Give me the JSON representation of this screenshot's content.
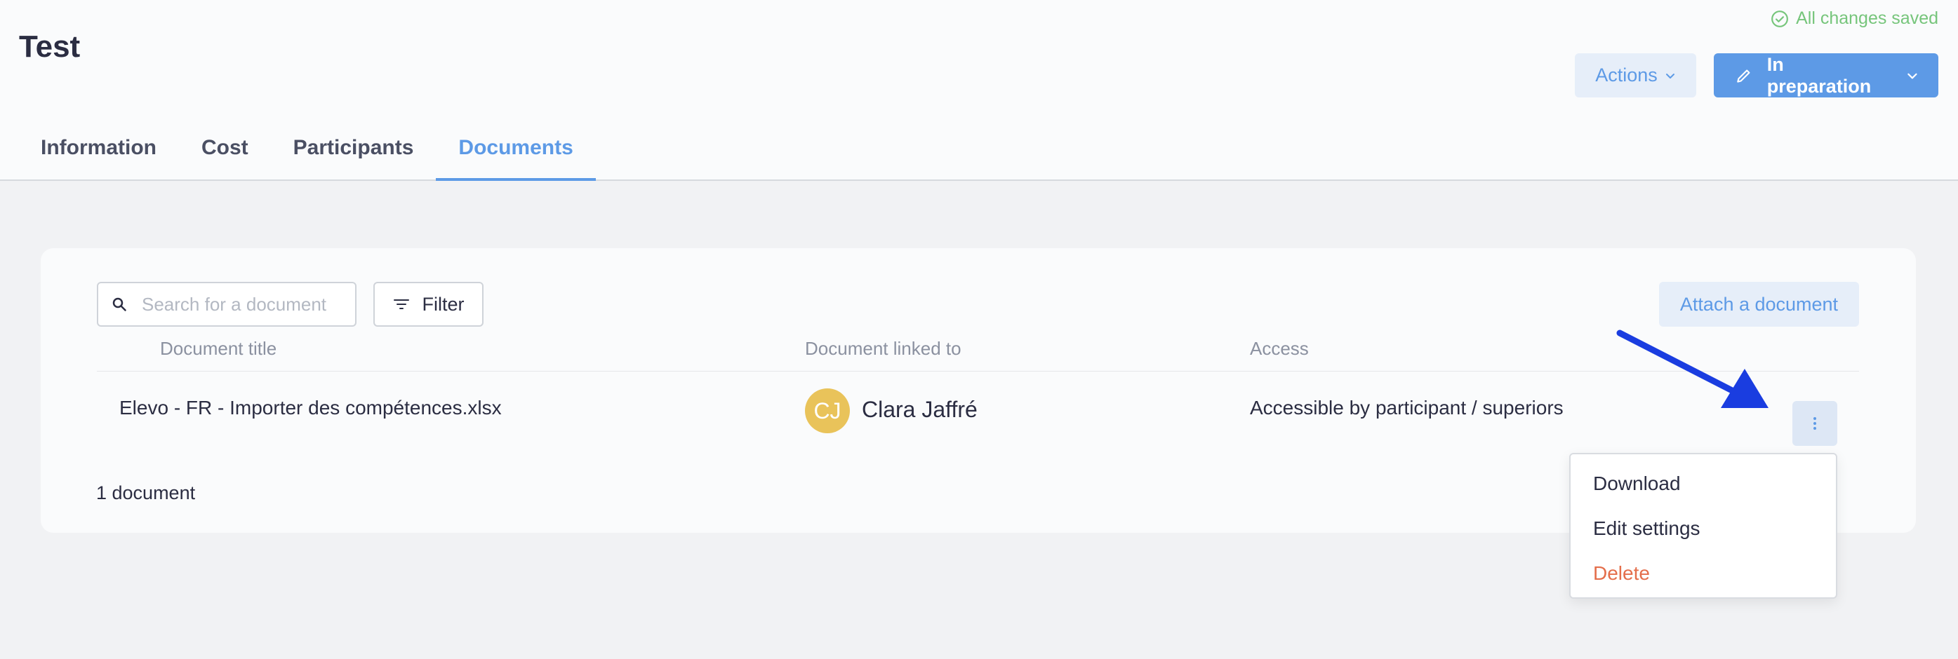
{
  "header": {
    "title": "Test",
    "saved_status": "All changes saved",
    "actions_label": "Actions",
    "status_label": "In preparation"
  },
  "tabs": [
    {
      "label": "Information"
    },
    {
      "label": "Cost"
    },
    {
      "label": "Participants"
    },
    {
      "label": "Documents",
      "active": true
    }
  ],
  "toolbar": {
    "search_placeholder": "Search for a document",
    "filter_label": "Filter",
    "attach_label": "Attach a document"
  },
  "table": {
    "columns": [
      "Document title",
      "Document linked to",
      "Access"
    ],
    "rows": [
      {
        "title": "Elevo - FR - Importer des compétences.xlsx",
        "linked_to": {
          "initials": "CJ",
          "name": "Clara Jaffré"
        },
        "access": "Accessible by participant / superiors"
      }
    ]
  },
  "footer": {
    "count": "1 document"
  },
  "context_menu": {
    "items": [
      {
        "label": "Download"
      },
      {
        "label": "Edit settings"
      },
      {
        "label": "Delete",
        "danger": true
      }
    ]
  },
  "colors": {
    "accent": "#5d9ae6",
    "success": "#76c57b",
    "danger": "#e46e4b",
    "avatar": "#e9c35a",
    "annotation_arrow": "#1a3de0"
  }
}
